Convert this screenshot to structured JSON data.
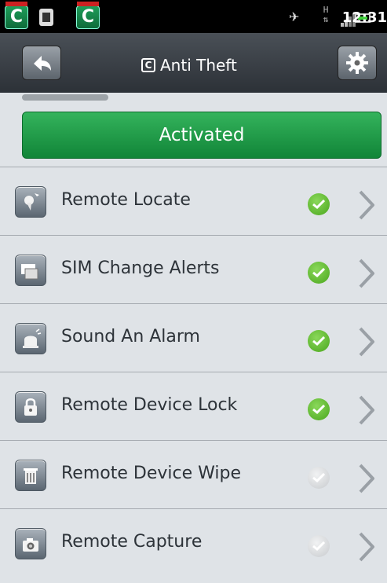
{
  "status_bar": {
    "time": "12:31",
    "network_label": "H",
    "icons": [
      "app-icon",
      "chip-icon",
      "app-icon",
      "satellite-icon",
      "network-icon",
      "signal-icon",
      "battery-icon"
    ]
  },
  "header": {
    "title": "Anti Theft",
    "back_icon": "back-arrow-icon",
    "settings_icon": "gear-icon"
  },
  "activation": {
    "label": "Activated",
    "color": "#1e9b45"
  },
  "features": [
    {
      "label": "Remote Locate",
      "icon": "locate-icon",
      "enabled": true
    },
    {
      "label": "SIM Change Alerts",
      "icon": "sim-icon",
      "enabled": true
    },
    {
      "label": "Sound An Alarm",
      "icon": "alarm-icon",
      "enabled": true
    },
    {
      "label": "Remote Device Lock",
      "icon": "lock-icon",
      "enabled": true
    },
    {
      "label": "Remote Device Wipe",
      "icon": "wipe-icon",
      "enabled": false
    },
    {
      "label": "Remote Capture",
      "icon": "camera-icon",
      "enabled": false
    }
  ],
  "colors": {
    "enabled": "#4aa61d",
    "disabled": "#c8cbce",
    "header": "#3a4047"
  }
}
